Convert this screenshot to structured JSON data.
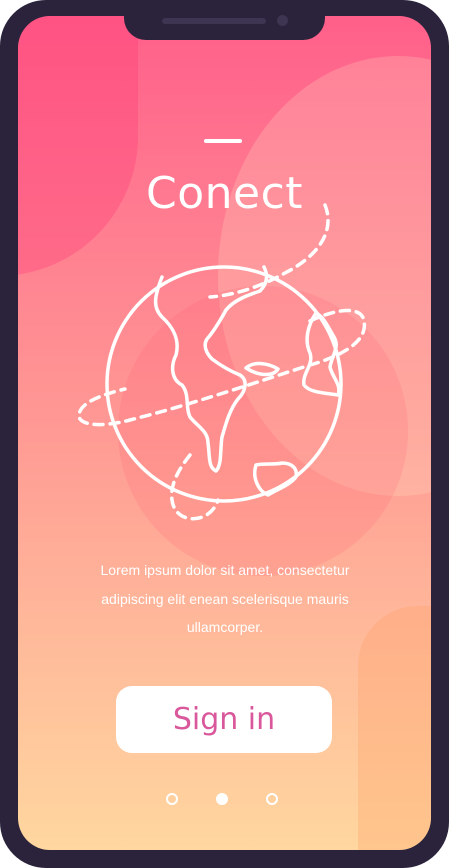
{
  "screen": {
    "title": "Conect",
    "body_lines": [
      "Lorem ipsum dolor sit amet, consectetur",
      "adipiscing elit enean scelerisque mauris",
      "ullamcorper."
    ],
    "signin_label": "Sign in",
    "pagination": {
      "total": 3,
      "active_index": 1
    },
    "illustration_icon": "globe-icon"
  },
  "colors": {
    "frame": "#2a233b",
    "gradient_top": "#ff5f8a",
    "gradient_bottom": "#ffd79f",
    "button_text": "#d9589c",
    "text": "#ffffff"
  }
}
